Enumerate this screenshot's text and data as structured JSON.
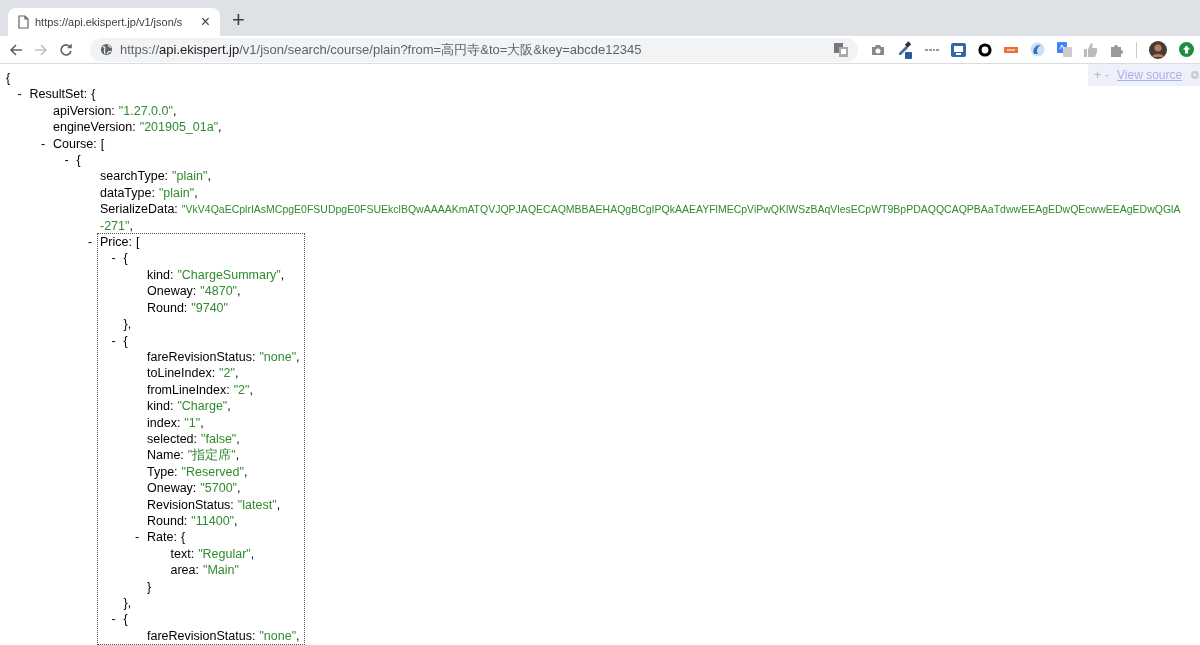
{
  "tab": {
    "title": "https://api.ekispert.jp/v1/json/s",
    "close": "×",
    "selected": true
  },
  "new_tab": "+",
  "nav_buttons": [
    {
      "kind": "back",
      "disabled": false
    },
    {
      "kind": "forward",
      "disabled": true
    },
    {
      "kind": "reload",
      "disabled": false
    }
  ],
  "url": {
    "scheme": "https://",
    "host": "api.ekispert.jp",
    "path": "/v1/json/search/course/plain?from=高円寺&to=大阪&key=abcde12345"
  },
  "viewer_controls": {
    "expand": "+",
    "collapse": "-",
    "link": "View source"
  },
  "document": {
    "open": "{",
    "children": [
      {
        "toggle": "-",
        "key": "ResultSet:",
        "open": "{",
        "children": [
          {
            "key": "apiVersion:",
            "value": "\"1.27.0.0\"",
            "trail": ","
          },
          {
            "key": "engineVersion:",
            "value": "\"201905_01a\"",
            "trail": ","
          },
          {
            "toggle": "-",
            "key": "Course:",
            "open": "[",
            "children": [
              {
                "toggle": "-",
                "open": "{",
                "children": [
                  {
                    "key": "searchType:",
                    "value": "\"plain\"",
                    "trail": ","
                  },
                  {
                    "key": "dataType:",
                    "value": "\"plain\"",
                    "trail": ","
                  },
                  {
                    "key": "SerializeData:",
                    "value": "\"VkV4QaECplrIAsMCpgE0FSUDpgE0FSUEkclBQwAAAAKmATQVJQPJAQECAQMBBAEHAQgBCgIPQkAAEAYFlMECpViPwQKlWSzBAqVlesECpWT9BpPDAQQCAQPBAaTdwwEEAgEDwQEcwwEEAgEDwQGlA",
                    "value_continued": "-271\"",
                    "trail": ","
                  },
                  {
                    "toggle": "-",
                    "key": "Price:",
                    "open": "[",
                    "highlighted": true,
                    "children": [
                      {
                        "toggle": "-",
                        "open": "{",
                        "close": "},",
                        "children": [
                          {
                            "key": "kind:",
                            "value": "\"ChargeSummary\"",
                            "trail": ","
                          },
                          {
                            "key": "Oneway:",
                            "value": "\"4870\"",
                            "trail": ","
                          },
                          {
                            "key": "Round:",
                            "value": "\"9740\""
                          }
                        ]
                      },
                      {
                        "toggle": "-",
                        "open": "{",
                        "close": "},",
                        "children": [
                          {
                            "key": "fareRevisionStatus:",
                            "value": "\"none\"",
                            "trail": ","
                          },
                          {
                            "key": "toLineIndex:",
                            "value": "\"2\"",
                            "trail": ","
                          },
                          {
                            "key": "fromLineIndex:",
                            "value": "\"2\"",
                            "trail": ","
                          },
                          {
                            "key": "kind:",
                            "value": "\"Charge\"",
                            "trail": ","
                          },
                          {
                            "key": "index:",
                            "value": "\"1\"",
                            "trail": ","
                          },
                          {
                            "key": "selected:",
                            "value": "\"false\"",
                            "trail": ","
                          },
                          {
                            "key": "Name:",
                            "value": "\"指定席\"",
                            "trail": ","
                          },
                          {
                            "key": "Type:",
                            "value": "\"Reserved\"",
                            "trail": ","
                          },
                          {
                            "key": "Oneway:",
                            "value": "\"5700\"",
                            "trail": ","
                          },
                          {
                            "key": "RevisionStatus:",
                            "value": "\"latest\"",
                            "trail": ","
                          },
                          {
                            "key": "Round:",
                            "value": "\"11400\"",
                            "trail": ","
                          },
                          {
                            "toggle": "-",
                            "key": "Rate:",
                            "open": "{",
                            "close": "}",
                            "children": [
                              {
                                "key": "text:",
                                "value": "\"Regular\"",
                                "trail": ","
                              },
                              {
                                "key": "area:",
                                "value": "\"Main\""
                              }
                            ]
                          }
                        ]
                      },
                      {
                        "toggle": "-",
                        "open": "{",
                        "children": [
                          {
                            "key": "fareRevisionStatus:",
                            "value": "\"none\"",
                            "trail": ","
                          }
                        ]
                      }
                    ]
                  }
                ]
              }
            ]
          }
        ]
      }
    ]
  }
}
